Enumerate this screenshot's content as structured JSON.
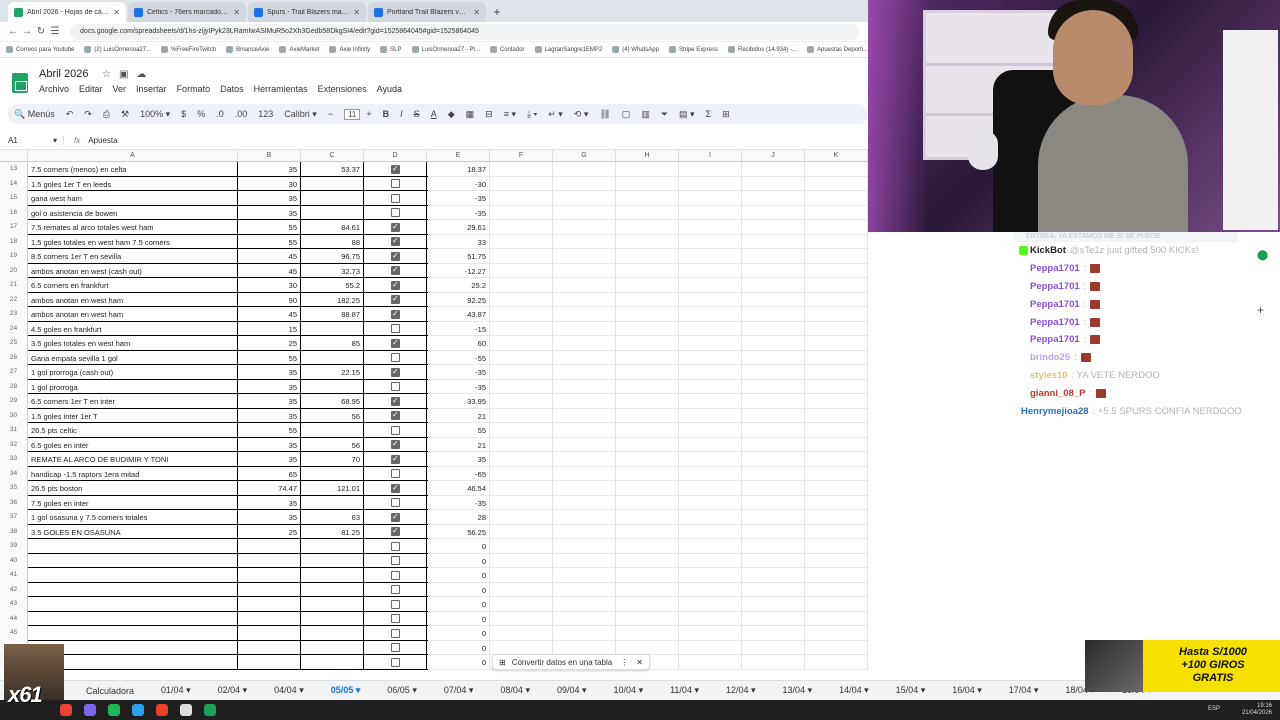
{
  "browser": {
    "tabs": [
      {
        "label": "Abril 2026 - Hojas de cálculo de",
        "active": true,
        "color": "#1fa463"
      },
      {
        "label": "Celtics - 76ers marcadores y p",
        "active": false,
        "color": "#1a73e8"
      },
      {
        "label": "Spurs - Trail Blazers marcado",
        "active": false,
        "color": "#1a73e8"
      },
      {
        "label": "Portland Trail Blazers vs San An",
        "active": false,
        "color": "#1a73e8"
      }
    ],
    "url": "docs.google.com/spreadsheets/d/1hs-zijyIPyk23LRamIwASlMuR5o2Xh3Gedb58DkgSI4/edit?gid=1525864045#gid=1525864045",
    "bookmarks": [
      "Correos para Youtube",
      "(2) LuisOrmenoa27...",
      "%FreeFireTwitch",
      "BinanceAxie",
      "AxieMarket",
      "Axie Infinity",
      "SLP",
      "LuisOrmenoa27 - Pl...",
      "Contador",
      "LagranSangre1EMP2",
      "(4) WhatsApp",
      "Stripe Express",
      "Recibidos (14.934) -...",
      "Apuestas Deporti..."
    ]
  },
  "doc": {
    "title": "Abril 2026",
    "menu": [
      "Archivo",
      "Editar",
      "Ver",
      "Insertar",
      "Formato",
      "Datos",
      "Herramientas",
      "Extensiones",
      "Ayuda"
    ]
  },
  "toolbar": {
    "menus": "Menús",
    "zoom": "100%",
    "currency": "$",
    "percent": "%",
    "dec_less": ".0",
    "dec_more": ".00",
    "numfmt": "123",
    "font": "Calibri",
    "font_size": "11",
    "bold": "B",
    "italic": "I",
    "strike": "S",
    "color": "A"
  },
  "formula_bar": {
    "cell": "A1",
    "fx": "fx",
    "value": "Apuesta"
  },
  "columns": [
    "A",
    "B",
    "C",
    "D",
    "E",
    "F",
    "G",
    "H",
    "I",
    "J",
    "K"
  ],
  "rows": [
    {
      "n": "13",
      "a": "7.5 corners (menos) en celta",
      "b": "35",
      "c": "53.37",
      "d": true,
      "e": "18.37"
    },
    {
      "n": "14",
      "a": "1.5 goles 1er T en leeds",
      "b": "30",
      "c": "",
      "d": false,
      "e": "-30"
    },
    {
      "n": "15",
      "a": "gana west ham",
      "b": "35",
      "c": "",
      "d": false,
      "e": "-35"
    },
    {
      "n": "16",
      "a": "gol o asistencia de bowen",
      "b": "35",
      "c": "",
      "d": false,
      "e": "-35"
    },
    {
      "n": "17",
      "a": "7.5 remates al arco totales west ham",
      "b": "55",
      "c": "84.61",
      "d": true,
      "e": "29.61"
    },
    {
      "n": "18",
      "a": "1.5 goles totales en west ham 7.5 corners",
      "b": "55",
      "c": "88",
      "d": true,
      "e": "33"
    },
    {
      "n": "19",
      "a": "8.5 corners 1er T en sevilla",
      "b": "45",
      "c": "96.75",
      "d": true,
      "e": "51.75"
    },
    {
      "n": "20",
      "a": "ambos anotan en west (cash out)",
      "b": "45",
      "c": "32.73",
      "d": true,
      "e": "-12.27"
    },
    {
      "n": "21",
      "a": "6.5 corners en frankfurt",
      "b": "30",
      "c": "55.2",
      "d": true,
      "e": "25.2"
    },
    {
      "n": "22",
      "a": "ambos anotan en west ham",
      "b": "90",
      "c": "182.25",
      "d": true,
      "e": "92.25"
    },
    {
      "n": "23",
      "a": "ambos anotan en west ham",
      "b": "45",
      "c": "88.87",
      "d": true,
      "e": "43.87"
    },
    {
      "n": "24",
      "a": "4.5 goles en frankfurt",
      "b": "15",
      "c": "",
      "d": false,
      "e": "-15"
    },
    {
      "n": "25",
      "a": "3.5 goles totales en west ham",
      "b": "25",
      "c": "85",
      "d": true,
      "e": "60"
    },
    {
      "n": "26",
      "a": "Gana empata sevilla 1 gol",
      "b": "55",
      "c": "",
      "d": false,
      "e": "-55"
    },
    {
      "n": "27",
      "a": "1 gol prorroga (cash out)",
      "b": "35",
      "c": "22.15",
      "d": true,
      "e": "-35"
    },
    {
      "n": "28",
      "a": "1 gol prorroga",
      "b": "35",
      "c": "",
      "d": false,
      "e": "-35"
    },
    {
      "n": "29",
      "a": "6.5 corners 1er T en inter",
      "b": "35",
      "c": "68.95",
      "d": true,
      "e": "33.95"
    },
    {
      "n": "30",
      "a": "1.5 goles inter 1er T",
      "b": "35",
      "c": "56",
      "d": true,
      "e": "21"
    },
    {
      "n": "31",
      "a": "26.5 pts celtic",
      "b": "55",
      "c": "",
      "d": false,
      "e": "55"
    },
    {
      "n": "32",
      "a": "6.5 goles en inter",
      "b": "35",
      "c": "56",
      "d": true,
      "e": "21"
    },
    {
      "n": "33",
      "a": "REMATE AL ARCO DE BUDIMIR Y TONI",
      "b": "35",
      "c": "70",
      "d": true,
      "e": "35"
    },
    {
      "n": "34",
      "a": "handicap -1.5 raptors 1era mitad",
      "b": "65",
      "c": "",
      "d": false,
      "e": "-65"
    },
    {
      "n": "35",
      "a": "26.5 pts boston",
      "b": "74.47",
      "c": "121.01",
      "d": true,
      "e": "46.54"
    },
    {
      "n": "36",
      "a": "7.5 goles en inter",
      "b": "35",
      "c": "",
      "d": false,
      "e": "-35"
    },
    {
      "n": "37",
      "a": "1 gol osasuna y 7.5 corners totales",
      "b": "35",
      "c": "63",
      "d": true,
      "e": "28"
    },
    {
      "n": "38",
      "a": "3.5 GOLES EN OSASUNA",
      "b": "25",
      "c": "81.25",
      "d": true,
      "e": "56.25"
    },
    {
      "n": "39",
      "a": "",
      "b": "",
      "c": "",
      "d": false,
      "e": "0"
    },
    {
      "n": "40",
      "a": "",
      "b": "",
      "c": "",
      "d": false,
      "e": "0"
    },
    {
      "n": "41",
      "a": "",
      "b": "",
      "c": "",
      "d": false,
      "e": "0"
    },
    {
      "n": "42",
      "a": "",
      "b": "",
      "c": "",
      "d": false,
      "e": "0"
    },
    {
      "n": "43",
      "a": "",
      "b": "",
      "c": "",
      "d": false,
      "e": "0"
    },
    {
      "n": "44",
      "a": "",
      "b": "",
      "c": "",
      "d": false,
      "e": "0"
    },
    {
      "n": "45",
      "a": "",
      "b": "",
      "c": "",
      "d": false,
      "e": "0"
    },
    {
      "n": "46",
      "a": "",
      "b": "",
      "c": "",
      "d": false,
      "e": "0"
    },
    {
      "n": "47",
      "a": "",
      "b": "",
      "c": "",
      "d": false,
      "e": "0"
    }
  ],
  "toast": {
    "label": "Convertir datos en una tabla"
  },
  "sheet_tabs": [
    "Calculadora",
    "01/04",
    "02/04",
    "04/04",
    "05/05",
    "06/05",
    "07/04",
    "08/04",
    "09/04",
    "10/04",
    "11/04",
    "12/04",
    "13/04",
    "14/04",
    "15/04",
    "16/04",
    "17/04",
    "18/04",
    "19/04"
  ],
  "active_sheet": "05/05",
  "chat": {
    "top_text": "ENTREA, YA ESTAMOS ME SI SE PUEDE",
    "messages": [
      {
        "user": "KickBot",
        "color": "#222222",
        "text": "@sTe1z just gifted 500 KICKs!",
        "emote": false
      },
      {
        "user": "Peppa1701",
        "color": "#8a4fd8",
        "text": ":",
        "emote": true
      },
      {
        "user": "Peppa1701",
        "color": "#8a4fd8",
        "text": ":",
        "emote": true
      },
      {
        "user": "Peppa1701",
        "color": "#8a4fd8",
        "text": ":",
        "emote": true
      },
      {
        "user": "Peppa1701",
        "color": "#8a4fd8",
        "text": ":",
        "emote": true
      },
      {
        "user": "Peppa1701",
        "color": "#8a4fd8",
        "text": ":",
        "emote": true
      },
      {
        "user": "brindo26",
        "color": "#b9a4e8",
        "text": ":",
        "emote": true
      },
      {
        "user": "styles10",
        "color": "#e8c074",
        "text": ": YA VETE NERDOO",
        "emote": false
      },
      {
        "user": "gianni_08_P",
        "color": "#c0392b",
        "text": ":",
        "emote": true
      },
      {
        "user": "Henrymejioa28",
        "color": "#2c6fbf",
        "text": ": +5.5 SPURS CONFIA NERDOOO",
        "emote": false
      }
    ]
  },
  "promo": {
    "line1": "Hasta S/1000",
    "line2": "+100 GIROS",
    "line3": "GRATIS"
  },
  "overlay": {
    "text": "x61"
  },
  "tray": {
    "lang": "ESP",
    "time": "19:16",
    "date": "21/04/2026"
  }
}
